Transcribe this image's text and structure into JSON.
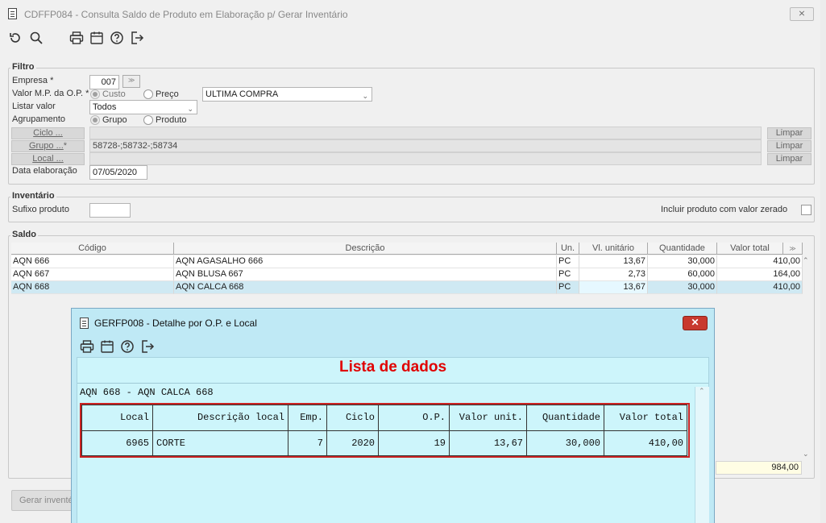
{
  "main": {
    "title": "CDFFP084 - Consulta Saldo de Produto em Elaboração p/ Gerar Inventário",
    "close_glyph": "⨯"
  },
  "toolbar": {
    "icons": [
      "refresh-icon",
      "search-icon",
      "print-icon",
      "calendar-icon",
      "help-icon",
      "exit-icon"
    ]
  },
  "filtro": {
    "label": "Filtro",
    "empresa_label": "Empresa *",
    "empresa_value": "007",
    "valor_mp_label": "Valor M.P. da O.P. *",
    "custo_label": "Custo",
    "preco_label": "Preço",
    "preco_select": "ULTIMA COMPRA",
    "listar_label": "Listar valor",
    "listar_value": "Todos",
    "agrup_label": "Agrupamento",
    "grupo_radio": "Grupo",
    "produto_radio": "Produto",
    "ciclo_btn": "Ciclo ...",
    "ciclo_value": "",
    "grupo_btn": "Grupo ...",
    "grupo_btn_suffix": "*",
    "grupo_value": "58728-;58732-;58734",
    "local_btn": "Local ...",
    "local_value": "",
    "limpar": "Limpar",
    "data_label": "Data elaboração",
    "data_value": "07/05/2020"
  },
  "inventario": {
    "label": "Inventário",
    "sufixo_label": "Sufixo produto",
    "sufixo_value": "",
    "incluir_label": "Incluir produto com valor zerado"
  },
  "saldo": {
    "label": "Saldo",
    "columns": [
      "Código",
      "Descrição",
      "Un.",
      "Vl. unitário",
      "Quantidade",
      "Valor total"
    ],
    "rows": [
      [
        "AQN 666",
        "AQN AGASALHO 666",
        "PC",
        "13,67",
        "30,000",
        "410,00"
      ],
      [
        "AQN 667",
        "AQN BLUSA 667",
        "PC",
        "2,73",
        "60,000",
        "164,00"
      ],
      [
        "AQN 668",
        "AQN CALCA 668",
        "PC",
        "13,67",
        "30,000",
        "410,00"
      ]
    ],
    "total": "984,00"
  },
  "bottom": {
    "gerar_label": "Gerar inventé"
  },
  "popup": {
    "title": "GERFP008 - Detalhe por O.P. e Local",
    "close_glyph": "✕",
    "heading": "Lista de dados",
    "heading_color": "#e00000",
    "subtitle": "AQN 668 - AQN CALCA 668",
    "columns": [
      "Local",
      "Descrição local",
      "Emp.",
      "Ciclo",
      "O.P.",
      "Valor unit.",
      "Quantidade",
      "Valor total"
    ],
    "row": [
      "6965",
      "CORTE",
      "7",
      "2020",
      "19",
      "13,67",
      "30,000",
      "410,00"
    ],
    "highlight_color": "#cc2222"
  }
}
